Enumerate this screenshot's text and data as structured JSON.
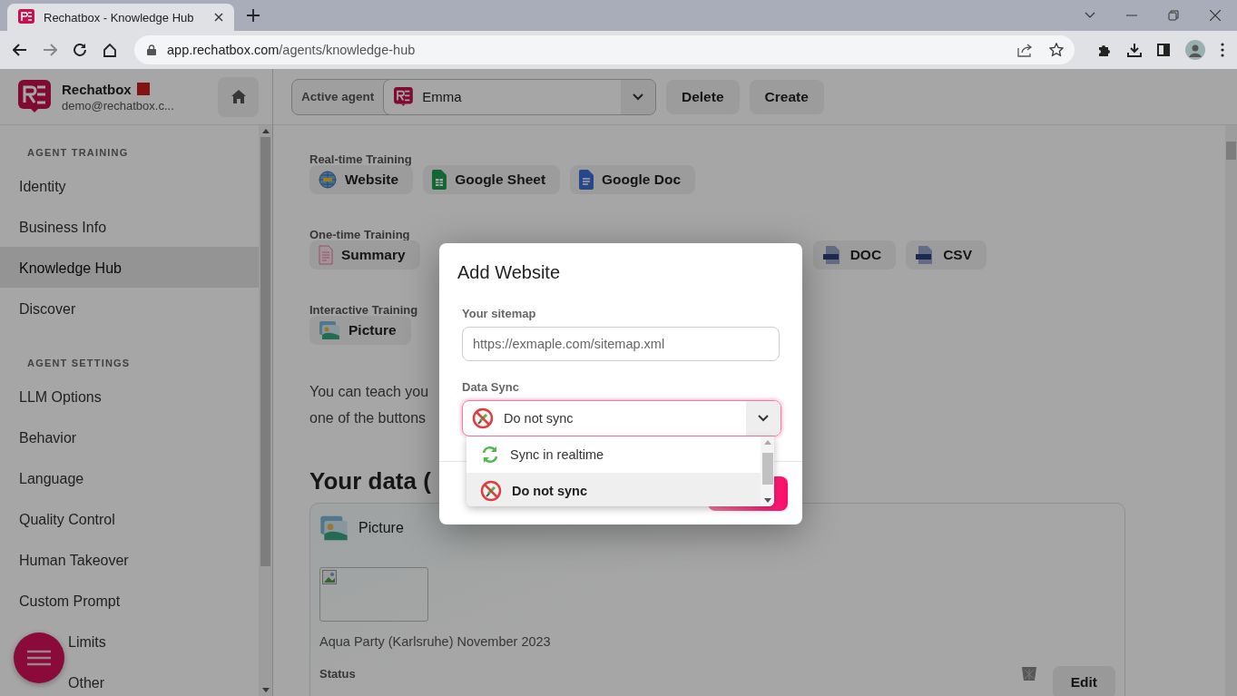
{
  "browser": {
    "tab_title": "Rechatbox - Knowledge Hub",
    "url_host": "app.rechatbox.com",
    "url_path": "/agents/knowledge-hub"
  },
  "header": {
    "brand": "Rechatbox",
    "email": "demo@rechatbox.c...",
    "active_agent_label": "Active agent",
    "agent": "Emma",
    "buttons": [
      "Delete",
      "Create"
    ]
  },
  "sidebar": {
    "sections": [
      {
        "title": "AGENT TRAINING",
        "items": [
          {
            "label": "Identity",
            "selected": false
          },
          {
            "label": "Business Info",
            "selected": false
          },
          {
            "label": "Knowledge Hub",
            "selected": true
          },
          {
            "label": "Discover",
            "selected": false
          }
        ]
      },
      {
        "title": "AGENT SETTINGS",
        "items": [
          {
            "label": "LLM Options",
            "selected": false
          },
          {
            "label": "Behavior",
            "selected": false
          },
          {
            "label": "Language",
            "selected": false
          },
          {
            "label": "Quality Control",
            "selected": false
          },
          {
            "label": "Human Takeover",
            "selected": false
          },
          {
            "label": "Custom Prompt",
            "selected": false
          },
          {
            "label": "Limits",
            "selected": false
          },
          {
            "label": "Other",
            "selected": false
          }
        ]
      }
    ]
  },
  "training_groups": [
    {
      "title": "Real-time Training",
      "buttons": [
        {
          "label": "Website",
          "kind": "globe"
        },
        {
          "label": "Google Sheet",
          "kind": "sheet"
        },
        {
          "label": "Google Doc",
          "kind": "gdoc"
        }
      ]
    },
    {
      "title": "One-time Training",
      "buttons": [
        {
          "label": "Summary",
          "kind": "summary"
        },
        {
          "label": "DOC",
          "kind": "doc"
        },
        {
          "label": "CSV",
          "kind": "csv"
        }
      ]
    },
    {
      "title": "Interactive Training",
      "buttons": [
        {
          "label": "Picture",
          "kind": "picture"
        }
      ]
    }
  ],
  "intro": [
    "You can teach you",
    "one of the buttons"
  ],
  "data_heading": "Your data (",
  "data_card": {
    "type_label": "Picture",
    "caption": "Aqua Party (Karlsruhe) November 2023",
    "status_label": "Status",
    "edit": "Edit"
  },
  "modal": {
    "title": "Add Website",
    "sitemap_label": "Your sitemap",
    "sitemap_placeholder": "https://exmaple.com/sitemap.xml",
    "sync_label": "Data Sync",
    "sync_value": "Do not sync",
    "options": [
      {
        "label": "Sync in realtime",
        "kind": "sync",
        "selected": false
      },
      {
        "label": "Do not sync",
        "kind": "nosync",
        "selected": true
      }
    ]
  }
}
